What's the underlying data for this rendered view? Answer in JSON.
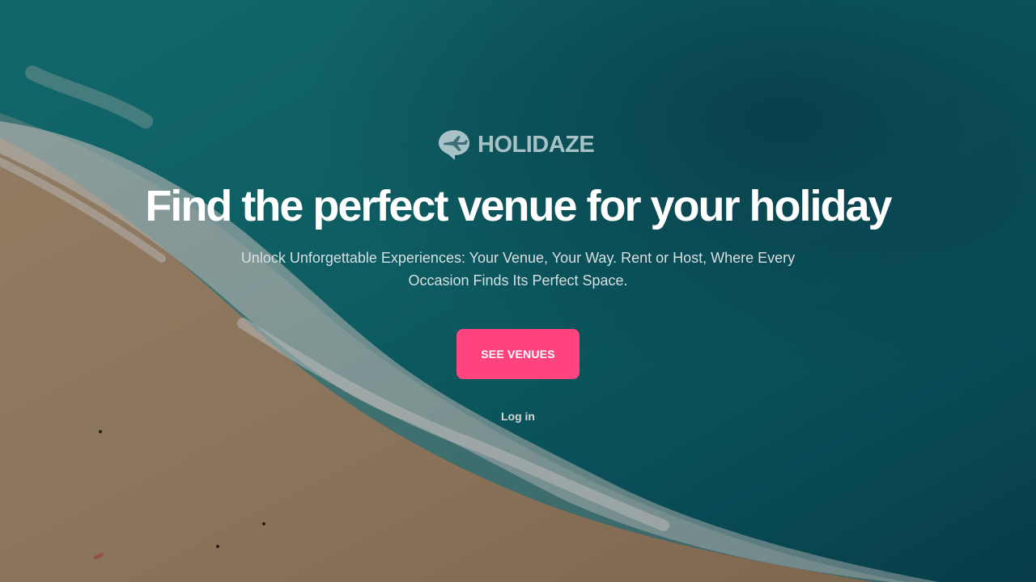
{
  "brand": {
    "name": "HOLIDAZE",
    "icon": "plane-chat-bubble-icon",
    "color": "#a7c2c6"
  },
  "hero": {
    "headline": "Find the perfect venue for your holiday",
    "subtitle": "Unlock Unforgettable Experiences: Your Venue, Your Way. Rent or Host, Where Every Occasion Finds Its Perfect Space.",
    "cta_label": "SEE VENUES",
    "login_label": "Log in",
    "background": "aerial-beach-ocean-waves-photo"
  },
  "colors": {
    "accent": "#ff4480",
    "ocean": "#0f6b70",
    "sand": "#b99b7a"
  }
}
